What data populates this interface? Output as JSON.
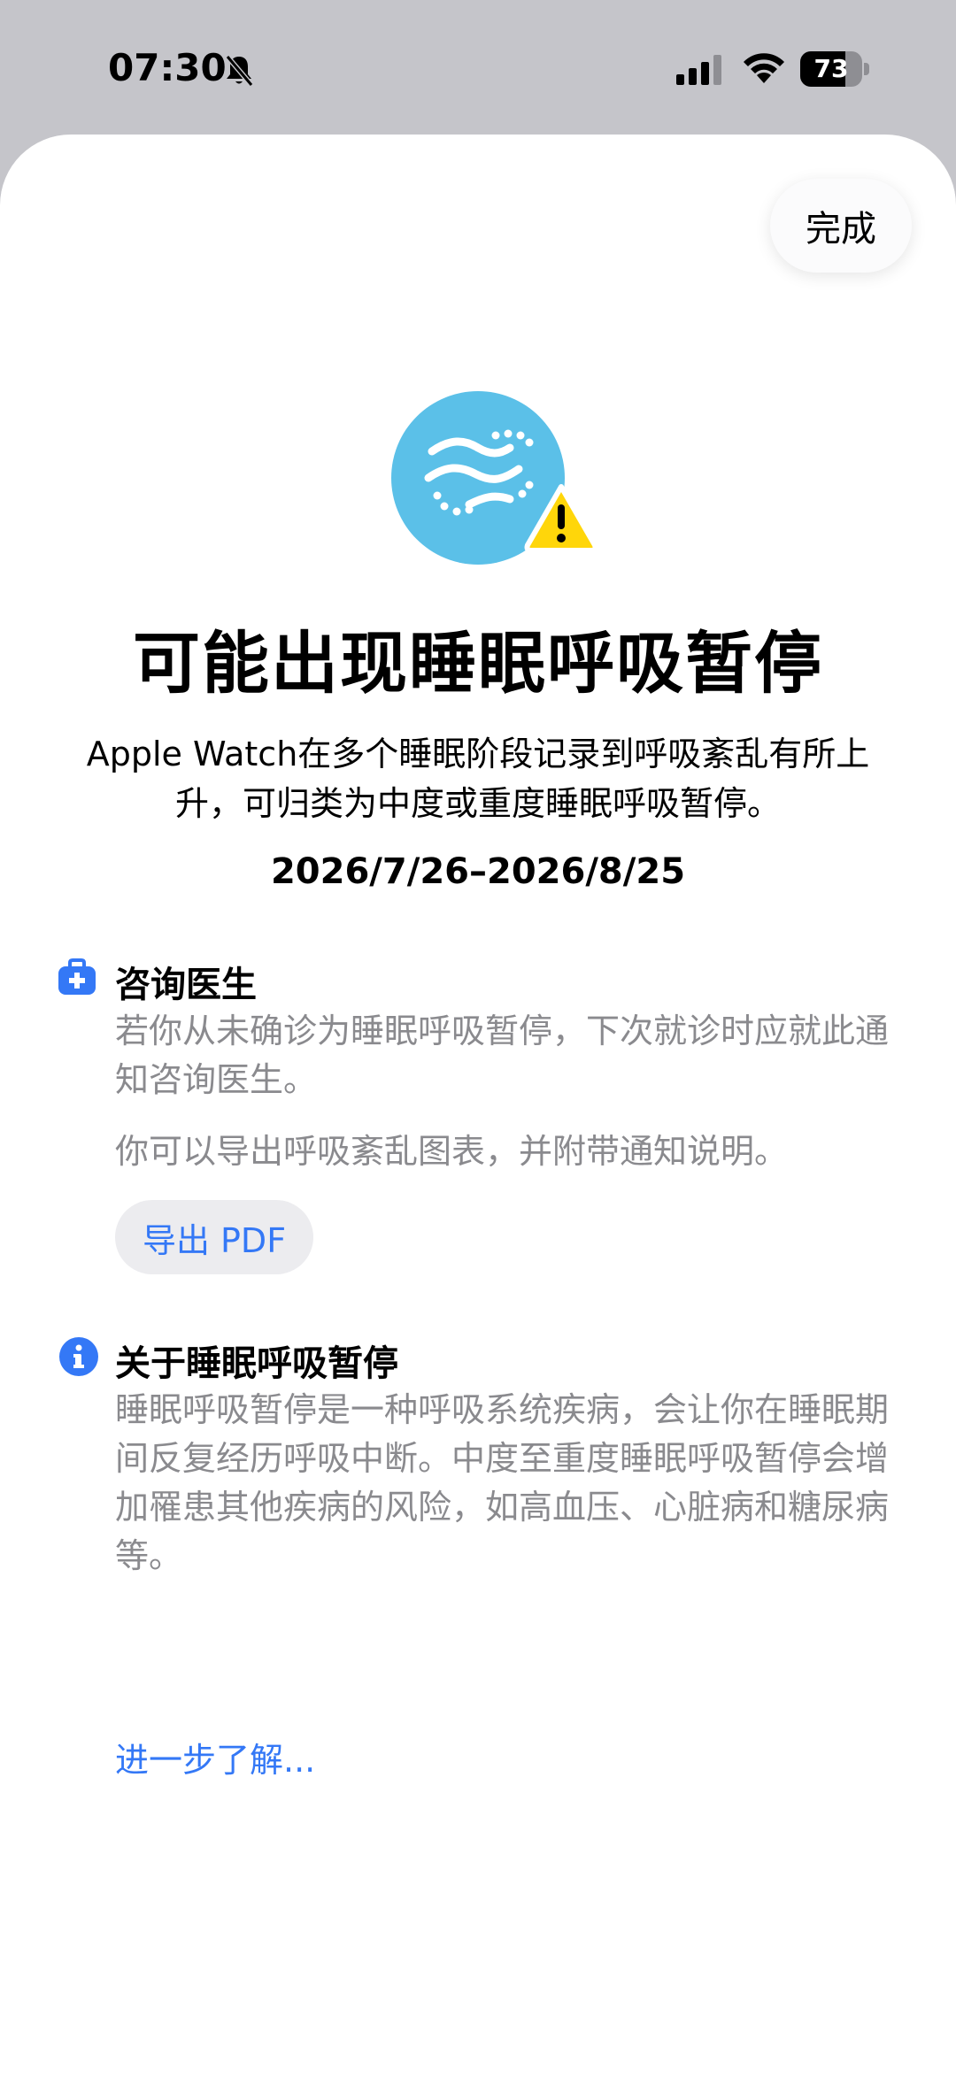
{
  "status_bar": {
    "time": "07:30",
    "battery": "73",
    "battery_level": 0.73
  },
  "toolbar": {
    "done_label": "完成"
  },
  "header": {
    "icon": "breathing-disturbance-warning-icon",
    "title": "可能出现睡眠呼吸暂停",
    "description": "Apple Watch在多个睡眠阶段记录到呼吸紊乱有所上升，可归类为中度或重度睡眠呼吸暂停。",
    "date_range": "2026/7/26–2026/8/25"
  },
  "consult_section": {
    "icon": "medical-kit-icon",
    "heading": "咨询医生",
    "body1": "若你从未确诊为睡眠呼吸暂停，下次就诊时应就此通知咨询医生。",
    "body2": "你可以导出呼吸紊乱图表，并附带通知说明。",
    "export_label": "导出 PDF"
  },
  "about_section": {
    "icon": "info-icon",
    "heading": "关于睡眠呼吸暂停",
    "body": "睡眠呼吸暂停是一种呼吸系统疾病，会让你在睡眠期间反复经历呼吸中断。中度至重度睡眠呼吸暂停会增加罹患其他疾病的风险，如高血压、心脏病和糖尿病等。",
    "learn_more": "进一步了解..."
  },
  "colors": {
    "accent": "#3478f6",
    "secondary_text": "#8a8a8e",
    "icon_circle": "#5bc0e8",
    "warning": "#ffd60a"
  }
}
